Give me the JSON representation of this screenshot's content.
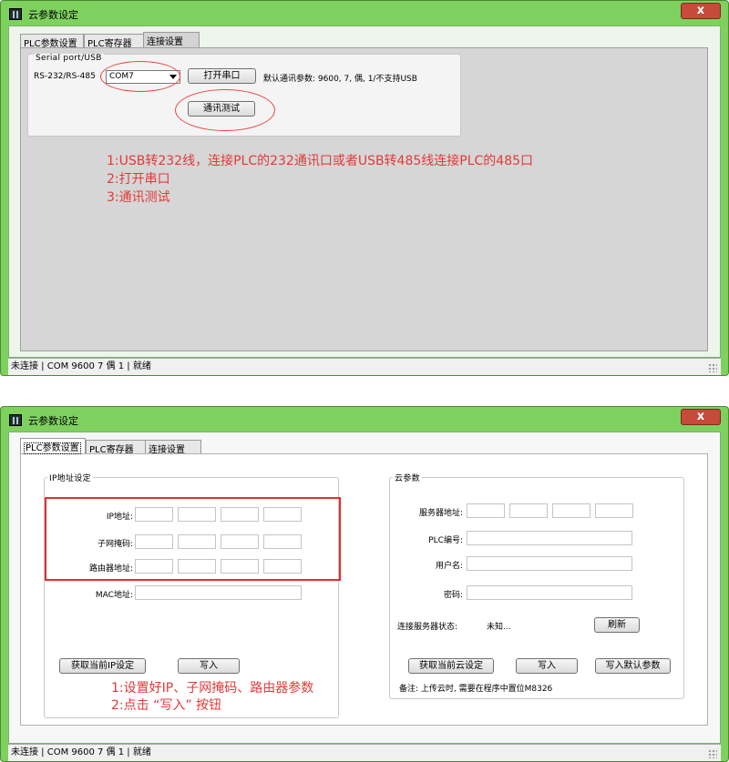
{
  "window1": {
    "title": "云参数设定",
    "close_label": "x",
    "tabs": [
      "PLC参数设置",
      "PLC寄存器",
      "连接设置"
    ],
    "group_title": "Serial port/USB",
    "port_label": "RS-232/RS-485",
    "port_select_value": "COM7",
    "open_port_button": "打开串口",
    "default_params_text": "默认通讯参数: 9600, 7, 偶, 1/不支持USB",
    "comm_test_button": "通讯测试",
    "annotations": [
      "1:USB转232线，连接PLC的232通讯口或者USB转485线连接PLC的485口",
      "2:打开串口",
      "3:通讯测试"
    ],
    "status_text": "未连接 | COM 9600 7 偶 1 | 就绪"
  },
  "window2": {
    "title": "云参数设定",
    "close_label": "x",
    "tabs": [
      "PLC参数设置",
      "PLC寄存器",
      "连接设置"
    ],
    "ip_group": {
      "title": "IP地址设定",
      "ip_label": "IP地址:",
      "mask_label": "子网掩码:",
      "gateway_label": "路由器地址:",
      "mac_label": "MAC地址:",
      "get_ip_button": "获取当前IP设定",
      "write_button": "写入"
    },
    "cloud_group": {
      "title": "云参数",
      "server_label": "服务器地址:",
      "plc_no_label": "PLC编号:",
      "username_label": "用户名:",
      "password_label": "密码:",
      "conn_state_label": "连接服务器状态:",
      "conn_state_value": "未知...",
      "refresh_button": "刷新",
      "get_cloud_button": "获取当前云设定",
      "write_button": "写入",
      "write_default_button": "写入默认参数",
      "note": "备注: 上传云时, 需要在程序中置位M8326"
    },
    "annotations": [
      "1:设置好IP、子网掩码、路由器参数",
      "2:点击 “写入” 按钮"
    ],
    "status_text": "未连接 | COM 9600 7 偶 1 | 就绪"
  }
}
